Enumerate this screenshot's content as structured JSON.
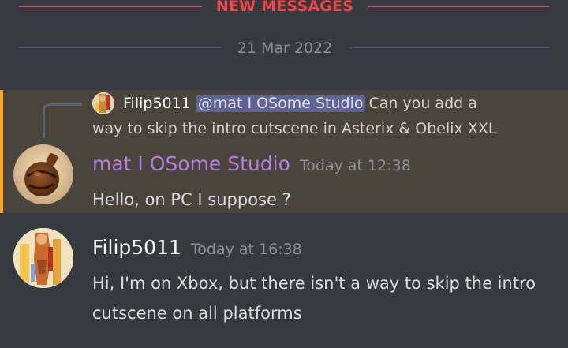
{
  "dividers": {
    "new_messages": "NEW MESSAGES",
    "date": "21 Mar 2022"
  },
  "reply_preview": {
    "author": "Filip5011",
    "mention": "@mat I OSome Studio",
    "text_line1": "Can you add a",
    "text_line2": "way to skip the intro cutscene in Asterix & Obelix XXL"
  },
  "messages": [
    {
      "author": "mat I OSome Studio",
      "time": "Today at 12:38",
      "content": "Hello, on PC I suppose ?",
      "author_color": "#b57edc",
      "highlighted": true
    },
    {
      "author": "Filip5011",
      "time": "Today at 16:38",
      "content": "Hi, I'm on Xbox, but there isn't a way to skip the intro cutscene on all platforms",
      "author_color": "#ffffff",
      "highlighted": false
    }
  ],
  "colors": {
    "background": "#36393f",
    "new_messages": "#f04747",
    "highlight": "#49443c",
    "highlight_bar": "#faa61a",
    "mention_bg": "#5e6391"
  },
  "icons": {
    "mat_avatar": "wooden-bomb-avatar",
    "filip_avatar": "character-avatar"
  }
}
